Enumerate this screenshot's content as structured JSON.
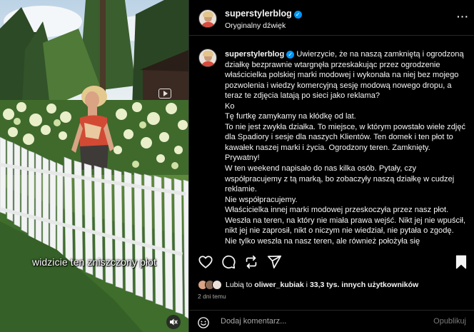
{
  "video": {
    "caption": "widzicie ten zniszczony płot"
  },
  "header": {
    "username": "superstylerblog",
    "audio_label": "Oryginalny dźwięk"
  },
  "post": {
    "username": "superstylerblog",
    "caption": "Uwierzycie, że na naszą zamkniętą i ogrodzoną działkę bezprawnie wtargnęła przeskakując przez ogrodzenie właścicielka polskiej marki modowej i wykonała na niej bez mojego pozwolenia i wiedzy komercyjną sesję modową nowego dropu, a teraz te zdjęcia latają po sieci jako reklama?\nKo\nTę furtkę zamykamy na kłódkę od lat.\nTo nie jest zwykła działka. To miejsce, w którym powstało wiele zdjęć dla Spadiory i sesje dla naszych Klientów. Ten domek i ten płot to kawałek naszej marki i życia. Ogrodzony teren. Zamknięty. Prywatny!\nW ten weekend napisało do nas kilka osób. Pytały, czy współpracujemy z tą marką, bo zobaczyły naszą działkę w cudzej reklamie.\nNie współpracujemy.\nWłaścicielka innej marki modowej przeskoczyła przez nasz płot. Weszła na teren, na który nie miała prawa wejść. Nikt jej nie wpuścił, nikt jej nie zaprosił, nikt o niczym nie wiedział, nie pytała o zgodę. Nie tylko weszła na nasz teren, ale również położyła się"
  },
  "likes": {
    "prefix": "Lubią to",
    "user": "oliwer_kubiak",
    "connector": "i",
    "others": "33,3 tys. innych użytkowników"
  },
  "timestamp": "2 dni temu",
  "comment_box": {
    "placeholder": "Dodaj komentarz...",
    "post_label": "Opublikuj"
  },
  "icons": {
    "heart": "heart-icon",
    "comment": "comment-icon",
    "repost": "repost-icon",
    "share": "share-icon",
    "save": "bookmark-icon",
    "emoji": "emoji-icon",
    "mute": "speaker-muted-icon",
    "reel": "reel-icon",
    "more": "more-icon"
  },
  "colors": {
    "verified": "#0095f6",
    "background": "#000000",
    "muted_text": "#a8a8a8",
    "divider": "#262626"
  }
}
